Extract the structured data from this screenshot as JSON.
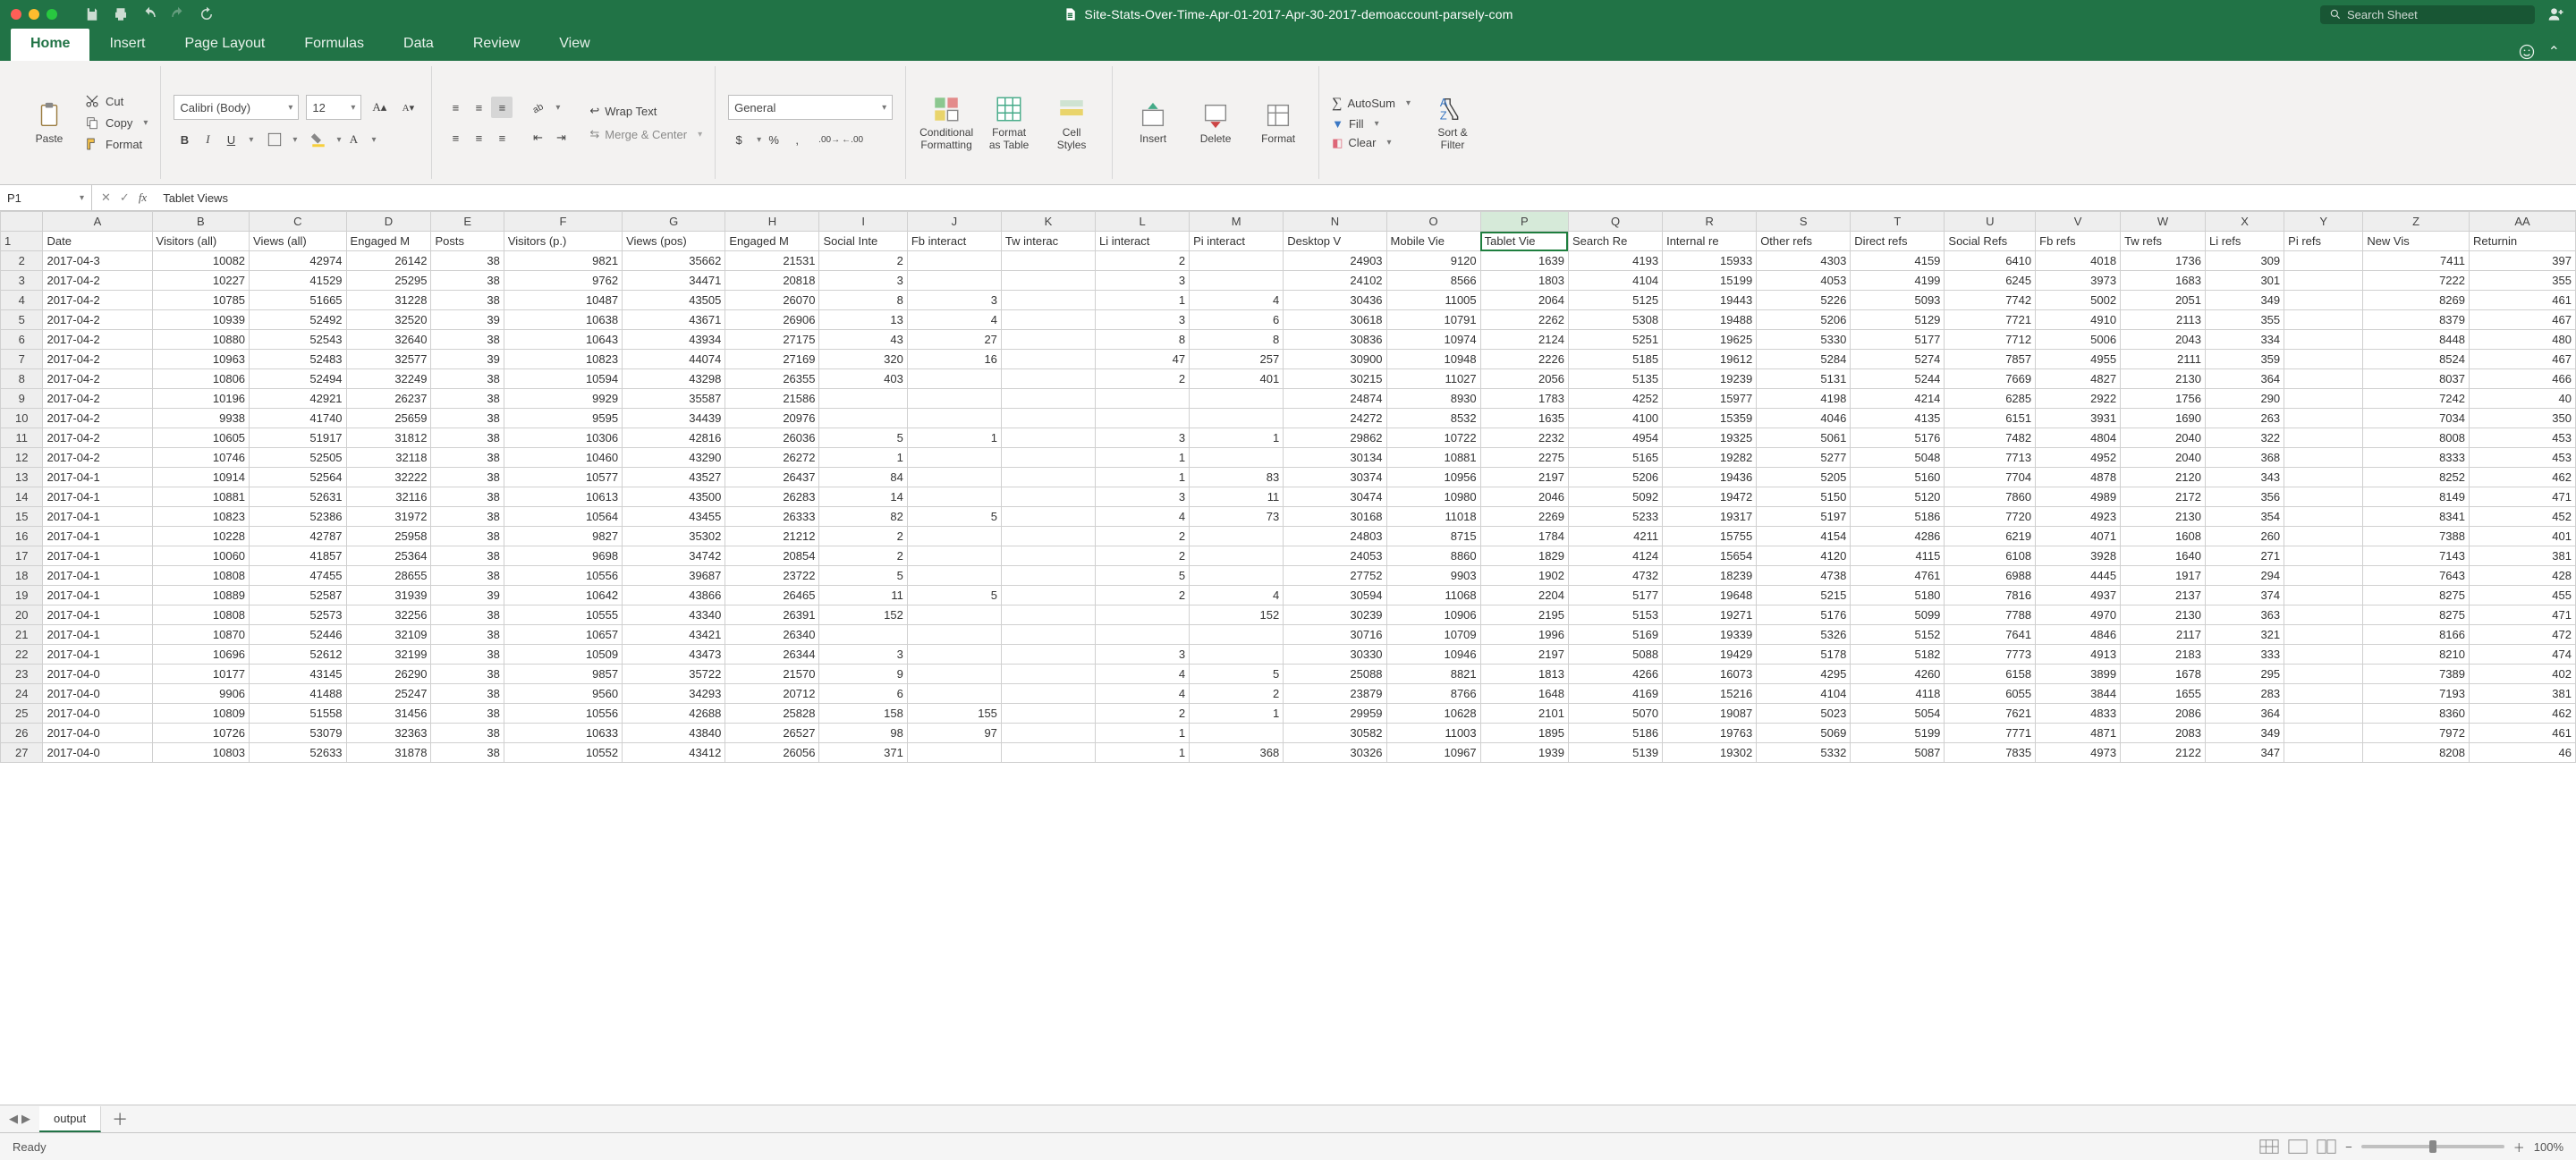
{
  "title": "Site-Stats-Over-Time-Apr-01-2017-Apr-30-2017-demoaccount-parsely-com",
  "search_placeholder": "Search Sheet",
  "tabs": [
    "Home",
    "Insert",
    "Page Layout",
    "Formulas",
    "Data",
    "Review",
    "View"
  ],
  "active_tab": 0,
  "clipboard": {
    "paste": "Paste",
    "cut": "Cut",
    "copy": "Copy",
    "format": "Format"
  },
  "font": {
    "name": "Calibri (Body)",
    "size": "12"
  },
  "alignment": {
    "wrap": "Wrap Text",
    "merge": "Merge & Center"
  },
  "number": {
    "format": "General"
  },
  "styles": {
    "cond": "Conditional\nFormatting",
    "table": "Format\nas Table",
    "cell": "Cell\nStyles"
  },
  "cells": {
    "insert": "Insert",
    "delete": "Delete",
    "format": "Format"
  },
  "editing": {
    "autosum": "AutoSum",
    "fill": "Fill",
    "clear": "Clear",
    "sort": "Sort &\nFilter"
  },
  "namebox": "P1",
  "formula": "Tablet Views",
  "columns": [
    "A",
    "B",
    "C",
    "D",
    "E",
    "F",
    "G",
    "H",
    "I",
    "J",
    "K",
    "L",
    "M",
    "N",
    "O",
    "P",
    "Q",
    "R",
    "S",
    "T",
    "U",
    "V",
    "W",
    "X",
    "Y",
    "Z",
    "AA"
  ],
  "col_widths": [
    "c-A",
    "c-B",
    "c-C",
    "c-D",
    "c-E",
    "c-F",
    "c-G",
    "c-H",
    "c-I",
    "c-J",
    "c-K",
    "c-L",
    "c-M",
    "c-N",
    "c-O",
    "c-P",
    "c-Q",
    "c-R",
    "c-S",
    "c-T",
    "c-U",
    "c-V",
    "c-W",
    "c-X",
    "c-Y",
    "c-Z",
    "c-AA"
  ],
  "selected_col": "P",
  "selected_cell": {
    "row": 1,
    "col": "P"
  },
  "headers_row": [
    "Date",
    "Visitors (all)",
    "Views (all)",
    "Engaged M",
    "Posts",
    "Visitors (p.)",
    "Views (pos)",
    "Engaged M",
    "Social Inte",
    "Fb interact",
    "Tw interac",
    "Li interact",
    "Pi interact",
    "Desktop V",
    "Mobile Vie",
    "Tablet Vie",
    "Search Re",
    "Internal re",
    "Other refs",
    "Direct refs",
    "Social Refs",
    "Fb refs",
    "Tw refs",
    "Li refs",
    "Pi refs",
    "New Vis",
    "Returnin"
  ],
  "data_rows": [
    [
      "2017-04-3",
      10082,
      42974,
      26142,
      38,
      9821,
      35662,
      21531,
      2,
      "",
      "",
      2,
      "",
      24903,
      9120,
      1639,
      4193,
      15933,
      4303,
      4159,
      6410,
      4018,
      1736,
      309,
      "",
      7411,
      397
    ],
    [
      "2017-04-2",
      10227,
      41529,
      25295,
      38,
      9762,
      34471,
      20818,
      3,
      "",
      "",
      3,
      "",
      24102,
      8566,
      1803,
      4104,
      15199,
      4053,
      4199,
      6245,
      3973,
      1683,
      301,
      "",
      7222,
      355
    ],
    [
      "2017-04-2",
      10785,
      51665,
      31228,
      38,
      10487,
      43505,
      26070,
      8,
      3,
      "",
      1,
      4,
      30436,
      11005,
      2064,
      5125,
      19443,
      5226,
      5093,
      7742,
      5002,
      2051,
      349,
      "",
      8269,
      461
    ],
    [
      "2017-04-2",
      10939,
      52492,
      32520,
      39,
      10638,
      43671,
      26906,
      13,
      4,
      "",
      3,
      6,
      30618,
      10791,
      2262,
      5308,
      19488,
      5206,
      5129,
      7721,
      4910,
      2113,
      355,
      "",
      8379,
      467
    ],
    [
      "2017-04-2",
      10880,
      52543,
      32640,
      38,
      10643,
      43934,
      27175,
      43,
      27,
      "",
      8,
      8,
      30836,
      10974,
      2124,
      5251,
      19625,
      5330,
      5177,
      7712,
      5006,
      2043,
      334,
      "",
      8448,
      480
    ],
    [
      "2017-04-2",
      10963,
      52483,
      32577,
      39,
      10823,
      44074,
      27169,
      320,
      16,
      "",
      47,
      257,
      30900,
      10948,
      2226,
      5185,
      19612,
      5284,
      5274,
      7857,
      4955,
      2111,
      359,
      "",
      8524,
      467
    ],
    [
      "2017-04-2",
      10806,
      52494,
      32249,
      38,
      10594,
      43298,
      26355,
      403,
      "",
      "",
      2,
      401,
      30215,
      11027,
      2056,
      5135,
      19239,
      5131,
      5244,
      7669,
      4827,
      2130,
      364,
      "",
      8037,
      466
    ],
    [
      "2017-04-2",
      10196,
      42921,
      26237,
      38,
      9929,
      35587,
      21586,
      "",
      "",
      "",
      "",
      "",
      24874,
      8930,
      1783,
      4252,
      15977,
      4198,
      4214,
      6285,
      2922,
      1756,
      290,
      "",
      7242,
      40
    ],
    [
      "2017-04-2",
      9938,
      41740,
      25659,
      38,
      9595,
      34439,
      20976,
      "",
      "",
      "",
      "",
      "",
      24272,
      8532,
      1635,
      4100,
      15359,
      4046,
      4135,
      6151,
      3931,
      1690,
      263,
      "",
      7034,
      350
    ],
    [
      "2017-04-2",
      10605,
      51917,
      31812,
      38,
      10306,
      42816,
      26036,
      5,
      1,
      "",
      3,
      1,
      29862,
      10722,
      2232,
      4954,
      19325,
      5061,
      5176,
      7482,
      4804,
      2040,
      322,
      "",
      8008,
      453
    ],
    [
      "2017-04-2",
      10746,
      52505,
      32118,
      38,
      10460,
      43290,
      26272,
      1,
      "",
      "",
      1,
      "",
      30134,
      10881,
      2275,
      5165,
      19282,
      5277,
      5048,
      7713,
      4952,
      2040,
      368,
      "",
      8333,
      453
    ],
    [
      "2017-04-1",
      10914,
      52564,
      32222,
      38,
      10577,
      43527,
      26437,
      84,
      "",
      "",
      1,
      83,
      30374,
      10956,
      2197,
      5206,
      19436,
      5205,
      5160,
      7704,
      4878,
      2120,
      343,
      "",
      8252,
      462
    ],
    [
      "2017-04-1",
      10881,
      52631,
      32116,
      38,
      10613,
      43500,
      26283,
      14,
      "",
      "",
      3,
      11,
      30474,
      10980,
      2046,
      5092,
      19472,
      5150,
      5120,
      7860,
      4989,
      2172,
      356,
      "",
      8149,
      471
    ],
    [
      "2017-04-1",
      10823,
      52386,
      31972,
      38,
      10564,
      43455,
      26333,
      82,
      5,
      "",
      4,
      73,
      30168,
      11018,
      2269,
      5233,
      19317,
      5197,
      5186,
      7720,
      4923,
      2130,
      354,
      "",
      8341,
      452
    ],
    [
      "2017-04-1",
      10228,
      42787,
      25958,
      38,
      9827,
      35302,
      21212,
      2,
      "",
      "",
      2,
      "",
      24803,
      8715,
      1784,
      4211,
      15755,
      4154,
      4286,
      6219,
      4071,
      1608,
      260,
      "",
      7388,
      401
    ],
    [
      "2017-04-1",
      10060,
      41857,
      25364,
      38,
      9698,
      34742,
      20854,
      2,
      "",
      "",
      2,
      "",
      24053,
      8860,
      1829,
      4124,
      15654,
      4120,
      4115,
      6108,
      3928,
      1640,
      271,
      "",
      7143,
      381
    ],
    [
      "2017-04-1",
      10808,
      47455,
      28655,
      38,
      10556,
      39687,
      23722,
      5,
      "",
      "",
      5,
      "",
      27752,
      9903,
      1902,
      4732,
      18239,
      4738,
      4761,
      6988,
      4445,
      1917,
      294,
      "",
      7643,
      428
    ],
    [
      "2017-04-1",
      10889,
      52587,
      31939,
      39,
      10642,
      43866,
      26465,
      11,
      5,
      "",
      2,
      4,
      30594,
      11068,
      2204,
      5177,
      19648,
      5215,
      5180,
      7816,
      4937,
      2137,
      374,
      "",
      8275,
      455
    ],
    [
      "2017-04-1",
      10808,
      52573,
      32256,
      38,
      10555,
      43340,
      26391,
      152,
      "",
      "",
      "",
      152,
      30239,
      10906,
      2195,
      5153,
      19271,
      5176,
      5099,
      7788,
      4970,
      2130,
      363,
      "",
      8275,
      471
    ],
    [
      "2017-04-1",
      10870,
      52446,
      32109,
      38,
      10657,
      43421,
      26340,
      "",
      "",
      "",
      "",
      "",
      30716,
      10709,
      1996,
      5169,
      19339,
      5326,
      5152,
      7641,
      4846,
      2117,
      321,
      "",
      8166,
      472
    ],
    [
      "2017-04-1",
      10696,
      52612,
      32199,
      38,
      10509,
      43473,
      26344,
      3,
      "",
      "",
      3,
      "",
      30330,
      10946,
      2197,
      5088,
      19429,
      5178,
      5182,
      7773,
      4913,
      2183,
      333,
      "",
      8210,
      474
    ],
    [
      "2017-04-0",
      10177,
      43145,
      26290,
      38,
      9857,
      35722,
      21570,
      9,
      "",
      "",
      4,
      5,
      25088,
      8821,
      1813,
      4266,
      16073,
      4295,
      4260,
      6158,
      3899,
      1678,
      295,
      "",
      7389,
      402
    ],
    [
      "2017-04-0",
      9906,
      41488,
      25247,
      38,
      9560,
      34293,
      20712,
      6,
      "",
      "",
      4,
      2,
      23879,
      8766,
      1648,
      4169,
      15216,
      4104,
      4118,
      6055,
      3844,
      1655,
      283,
      "",
      7193,
      381
    ],
    [
      "2017-04-0",
      10809,
      51558,
      31456,
      38,
      10556,
      42688,
      25828,
      158,
      155,
      "",
      2,
      1,
      29959,
      10628,
      2101,
      5070,
      19087,
      5023,
      5054,
      7621,
      4833,
      2086,
      364,
      "",
      8360,
      462
    ],
    [
      "2017-04-0",
      10726,
      53079,
      32363,
      38,
      10633,
      43840,
      26527,
      98,
      97,
      "",
      1,
      "",
      30582,
      11003,
      1895,
      5186,
      19763,
      5069,
      5199,
      7771,
      4871,
      2083,
      349,
      "",
      7972,
      461
    ],
    [
      "2017-04-0",
      10803,
      52633,
      31878,
      38,
      10552,
      43412,
      26056,
      371,
      "",
      "",
      1,
      368,
      30326,
      10967,
      1939,
      5139,
      19302,
      5332,
      5087,
      7835,
      4973,
      2122,
      347,
      "",
      8208,
      46
    ]
  ],
  "sheet_name": "output",
  "status_text": "Ready",
  "zoom": "100%"
}
